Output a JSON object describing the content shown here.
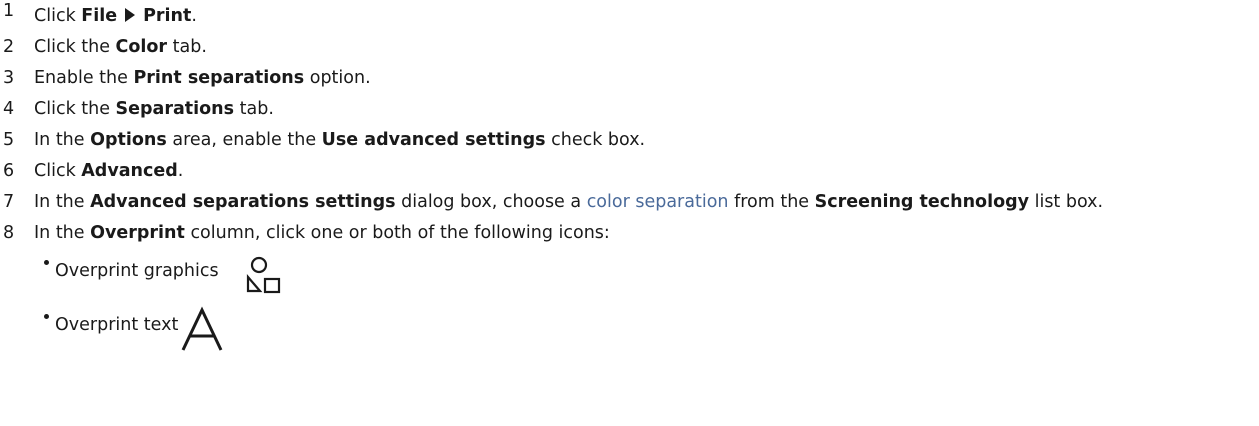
{
  "steps": [
    {
      "num": "1",
      "t1": "Click ",
      "b1": "File",
      "b2": "Print",
      "t2": "."
    },
    {
      "num": "2",
      "t1": "Click the ",
      "b1": "Color",
      "t2": " tab."
    },
    {
      "num": "3",
      "t1": "Enable the ",
      "b1": "Print separations",
      "t2": " option."
    },
    {
      "num": "4",
      "t1": "Click the ",
      "b1": "Separations",
      "t2": " tab."
    },
    {
      "num": "5",
      "t1": "In the ",
      "b1": "Options",
      "t2": " area, enable the ",
      "b2": "Use advanced settings",
      "t3": " check box."
    },
    {
      "num": "6",
      "t1": "Click ",
      "b1": "Advanced",
      "t2": "."
    },
    {
      "num": "7",
      "t1": "In the ",
      "b1": "Advanced separations settings",
      "t2": " dialog box, choose a ",
      "link": "color separation",
      "t3": " from the ",
      "b2": "Screening technology",
      "t4": " list box."
    },
    {
      "num": "8",
      "t1": "In the ",
      "b1": "Overprint",
      "t2": " column, click one or both of the following icons:"
    }
  ],
  "bullets": [
    {
      "label": "Overprint graphics",
      "icon": "overprint-graphics-icon"
    },
    {
      "label": "Overprint text",
      "icon": "overprint-text-icon"
    }
  ],
  "colors": {
    "text": "#1a1a1a",
    "link": "#4a6a9a"
  }
}
